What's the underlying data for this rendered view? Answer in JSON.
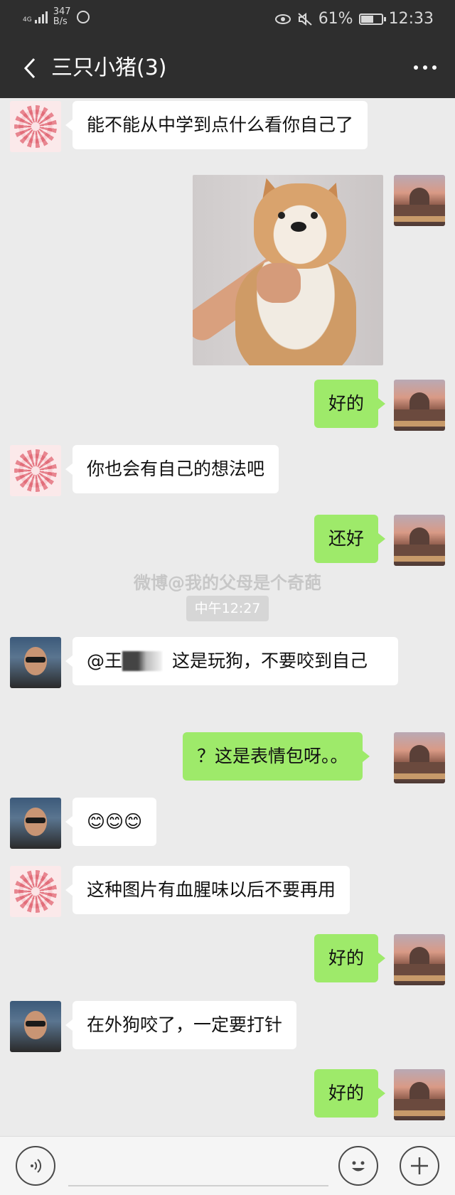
{
  "status": {
    "network": "4G",
    "speed_value": "347",
    "speed_unit": "B/s",
    "battery_percent": "61%",
    "battery_level": 0.61,
    "time": "12:33"
  },
  "header": {
    "back_icon": "chevron-left-icon",
    "title": "三只小猪(3)",
    "more_icon": "more-dots-icon"
  },
  "messages": [
    {
      "side": "in",
      "avatar": "flower",
      "text": "能不能从中学到点什么看你自己了"
    },
    {
      "side": "out",
      "avatar": "city",
      "type": "image",
      "image_desc": "shiba-dog-image"
    },
    {
      "side": "out",
      "avatar": "city",
      "text": "好的"
    },
    {
      "side": "in",
      "avatar": "flower",
      "text": "你也会有自己的想法吧"
    },
    {
      "side": "out",
      "avatar": "city",
      "text": "还好"
    },
    {
      "side": "in",
      "avatar": "person",
      "text_prefix": "@王",
      "text": "这是玩狗，不要咬到自己"
    },
    {
      "side": "out",
      "avatar": "city",
      "text": "？这是表情包呀。。"
    },
    {
      "side": "in",
      "avatar": "person",
      "text": "😊😊😊"
    },
    {
      "side": "in",
      "avatar": "flower",
      "text": "这种图片有血腥味以后不要再用"
    },
    {
      "side": "out",
      "avatar": "city",
      "text": "好的"
    },
    {
      "side": "in",
      "avatar": "person",
      "text": "在外狗咬了，一定要打针"
    },
    {
      "side": "out",
      "avatar": "city",
      "text": "好的"
    }
  ],
  "watermark": "微博@我的父母是个奇葩",
  "time_divider": "中午12:27",
  "input_bar": {
    "voice_icon": "voice-icon",
    "emoji_icon": "emoji-icon",
    "plus_icon": "plus-icon"
  },
  "colors": {
    "header_bg": "#2e2e2e",
    "chat_bg": "#ebebeb",
    "outgoing_bubble": "#9eea6a",
    "incoming_bubble": "#ffffff"
  }
}
